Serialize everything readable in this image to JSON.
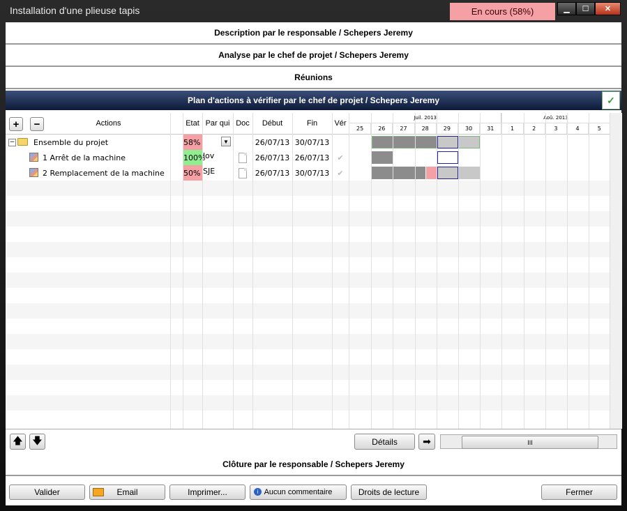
{
  "window": {
    "title": "Installation d'une plieuse tapis",
    "status": "En cours (58%)",
    "min": "▁",
    "max": "☐",
    "close": "✕"
  },
  "sections": {
    "description": "Description par le responsable / Schepers Jeremy",
    "analyse": "Analyse par le chef de projet / Schepers Jeremy",
    "reunions": "Réunions",
    "plan": "Plan d'actions à vérifier par le chef de projet / Schepers Jeremy",
    "cloture": "Clôture par le responsable / Schepers Jeremy"
  },
  "columns": {
    "actions": "Actions",
    "etat": "Etat",
    "par_qui": "Par qui",
    "doc": "Doc",
    "debut": "Début",
    "fin": "Fin",
    "ver": "Vér"
  },
  "gantt": {
    "months": [
      "Juil. 2013",
      "Aoû. 2013"
    ],
    "days": [
      "25",
      "26",
      "27",
      "28",
      "29",
      "30",
      "31",
      "1",
      "2",
      "3",
      "4",
      "5"
    ]
  },
  "rows": [
    {
      "expander": "−",
      "name": "Ensemble du projet",
      "etat": "58%",
      "etat_color": "#f4a0a4",
      "par_qui": "",
      "debut": "26/07/13",
      "fin": "30/07/13",
      "ver": ""
    },
    {
      "name": "1 Arrêt de la machine",
      "etat": "100%",
      "etat_color": "#90ee90",
      "par_qui": "lov",
      "debut": "26/07/13",
      "fin": "26/07/13",
      "ver": "✔"
    },
    {
      "name": "2 Remplacement de la machine",
      "etat": "50%",
      "etat_color": "#f4a0a4",
      "par_qui": "SJE",
      "debut": "26/07/13",
      "fin": "30/07/13",
      "ver": "✔"
    }
  ],
  "toolbar": {
    "add": "+",
    "remove": "−",
    "up": "🡅",
    "down": "🡇",
    "details": "Détails",
    "arrow": "➡",
    "scroll_thumb": "III"
  },
  "buttons": {
    "valider": "Valider",
    "email": "Email",
    "imprimer": "Imprimer...",
    "commentaire": "Aucun commentaire",
    "droits": "Droits de lecture",
    "fermer": "Fermer"
  }
}
